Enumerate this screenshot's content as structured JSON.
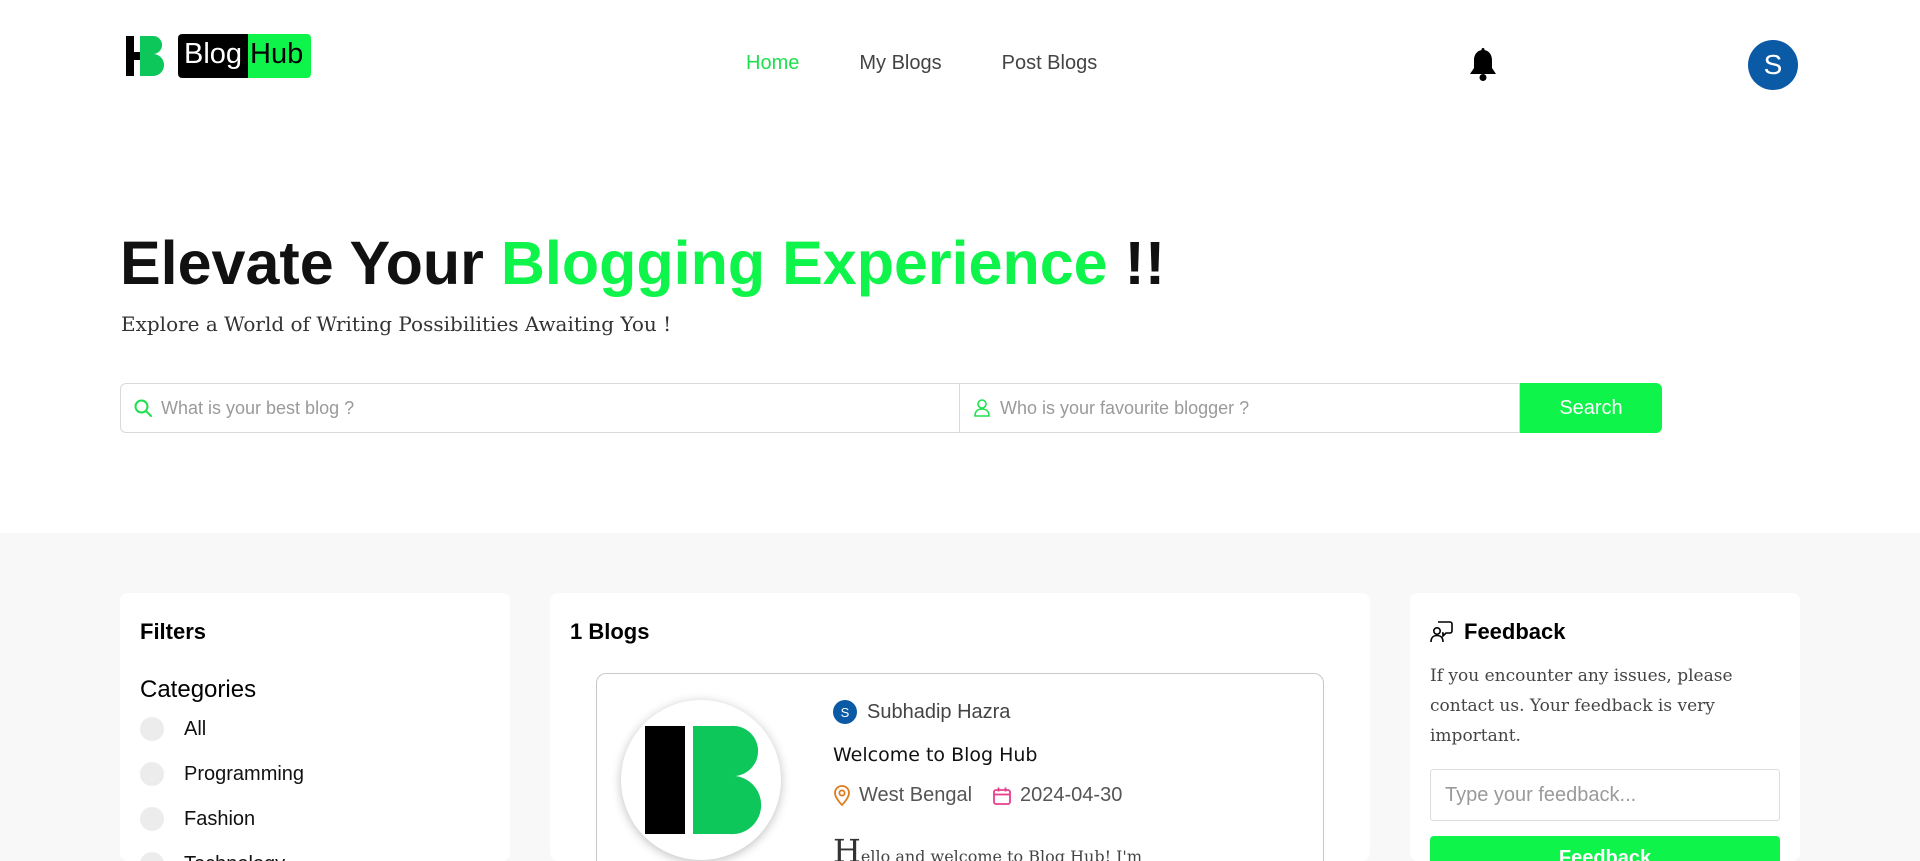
{
  "brand": {
    "part1": "Blog",
    "part2": "Hub"
  },
  "nav": {
    "items": [
      {
        "label": "Home",
        "active": true
      },
      {
        "label": "My Blogs",
        "active": false
      },
      {
        "label": "Post Blogs",
        "active": false
      }
    ]
  },
  "user": {
    "initial": "S"
  },
  "hero": {
    "title_start": "Elevate Your ",
    "title_accent": "Blogging Experience",
    "title_end": " !!",
    "subtitle": "Explore a World of Writing Possibilities Awaiting You !"
  },
  "search": {
    "blog_placeholder": "What is your best blog ?",
    "blogger_placeholder": "Who is your favourite blogger ?",
    "button_label": "Search"
  },
  "filters": {
    "title": "Filters",
    "categories_label": "Categories",
    "categories": [
      "All",
      "Programming",
      "Fashion",
      "Technology"
    ]
  },
  "blogs": {
    "count_label": "1 Blogs",
    "items": [
      {
        "author_initial": "S",
        "author": "Subhadip Hazra",
        "title": "Welcome to Blog Hub",
        "location": "West Bengal",
        "date": "2024-04-30",
        "excerpt_dropcap": "H",
        "excerpt": "ello and welcome to Blog Hub! I'm"
      }
    ]
  },
  "feedback": {
    "title": "Feedback",
    "text": "If you encounter any issues, please contact us. Your feedback is very important.",
    "placeholder": "Type your feedback...",
    "button_label": "Feedback"
  },
  "colors": {
    "accent": "#0ef44a",
    "nav_active": "#1ee04f",
    "avatar": "#0b5aa6",
    "band": "#f8f8f8"
  },
  "icons": [
    "logo-hb-icon",
    "bell-icon",
    "search-icon",
    "user-icon",
    "location-icon",
    "calendar-icon",
    "feedback-icon"
  ]
}
